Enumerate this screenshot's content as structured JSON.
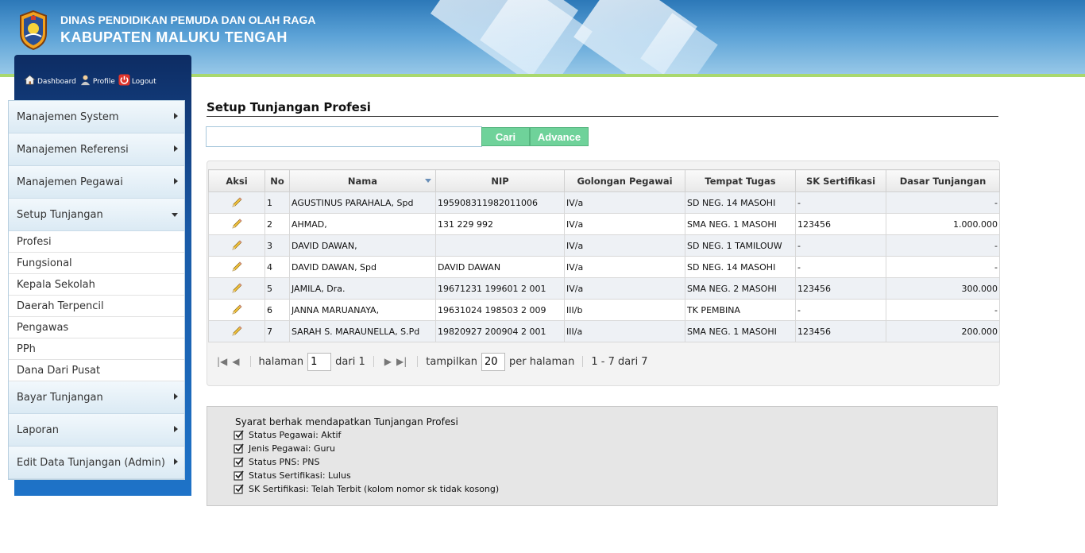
{
  "header": {
    "line1": "DINAS PENDIDIKAN PEMUDA DAN OLAH RAGA",
    "line2": "KABUPATEN MALUKU TENGAH"
  },
  "quicklinks": [
    {
      "label": "Dashboard",
      "icon": "home-icon"
    },
    {
      "label": "Profile",
      "icon": "user-icon"
    },
    {
      "label": "Logout",
      "icon": "power-icon"
    }
  ],
  "menu": {
    "items": [
      {
        "label": "Manajemen System"
      },
      {
        "label": "Manajemen Referensi"
      },
      {
        "label": "Manajemen Pegawai"
      },
      {
        "label": "Setup Tunjangan",
        "expanded": true,
        "children": [
          "Profesi",
          "Fungsional",
          "Kepala Sekolah",
          "Daerah Terpencil",
          "Pengawas",
          "PPh",
          "Dana Dari Pusat"
        ]
      },
      {
        "label": "Bayar Tunjangan"
      },
      {
        "label": "Laporan"
      },
      {
        "label": "Edit Data Tunjangan (Admin)"
      }
    ]
  },
  "page": {
    "title": "Setup Tunjangan Profesi",
    "search_placeholder": "",
    "btn_cari": "Cari",
    "btn_advance": "Advance"
  },
  "grid": {
    "columns": [
      "Aksi",
      "No",
      "Nama",
      "NIP",
      "Golongan Pegawai",
      "Tempat Tugas",
      "SK Sertifikasi",
      "Dasar Tunjangan"
    ],
    "rows": [
      [
        "1",
        "AGUSTINUS PARAHALA, Spd",
        "195908311982011006",
        "IV/a",
        "SD NEG. 14 MASOHI",
        "-",
        "-"
      ],
      [
        "2",
        "AHMAD,",
        "131 229 992",
        "IV/a",
        "SMA NEG. 1 MASOHI",
        "123456",
        "1.000.000"
      ],
      [
        "3",
        "DAVID DAWAN,",
        "",
        "IV/a",
        "SD NEG. 1 TAMILOUW",
        "-",
        "-"
      ],
      [
        "4",
        "DAVID DAWAN, Spd",
        "DAVID DAWAN",
        "IV/a",
        "SD NEG. 14 MASOHI",
        "-",
        "-"
      ],
      [
        "5",
        "JAMILA, Dra.",
        "19671231 199601 2 001",
        "IV/a",
        "SMA NEG. 2 MASOHI",
        "123456",
        "300.000"
      ],
      [
        "6",
        "JANNA MARUANAYA,",
        "19631024 198503 2 009",
        "III/b",
        "TK PEMBINA",
        "-",
        "-"
      ],
      [
        "7",
        "SARAH S. MARAUNELLA, S.Pd",
        "19820927 200904 2 001",
        "III/a",
        "SMA NEG. 1 MASOHI",
        "123456",
        "200.000"
      ]
    ]
  },
  "pager": {
    "halaman_label": "halaman",
    "page": "1",
    "dari_label": "dari 1",
    "tampilkan_label": "tampilkan",
    "per_page": "20",
    "per_halaman_label": "per halaman",
    "range_text": "1 - 7 dari 7"
  },
  "info": {
    "title": "Syarat berhak mendapatkan Tunjangan Profesi",
    "items": [
      "Status Pegawai: Aktif",
      "Jenis Pegawai: Guru",
      "Status PNS: PNS",
      "Status Sertifikasi: Lulus",
      "SK Sertifikasi: Telah Terbit (kolom nomor sk tidak kosong)"
    ]
  }
}
